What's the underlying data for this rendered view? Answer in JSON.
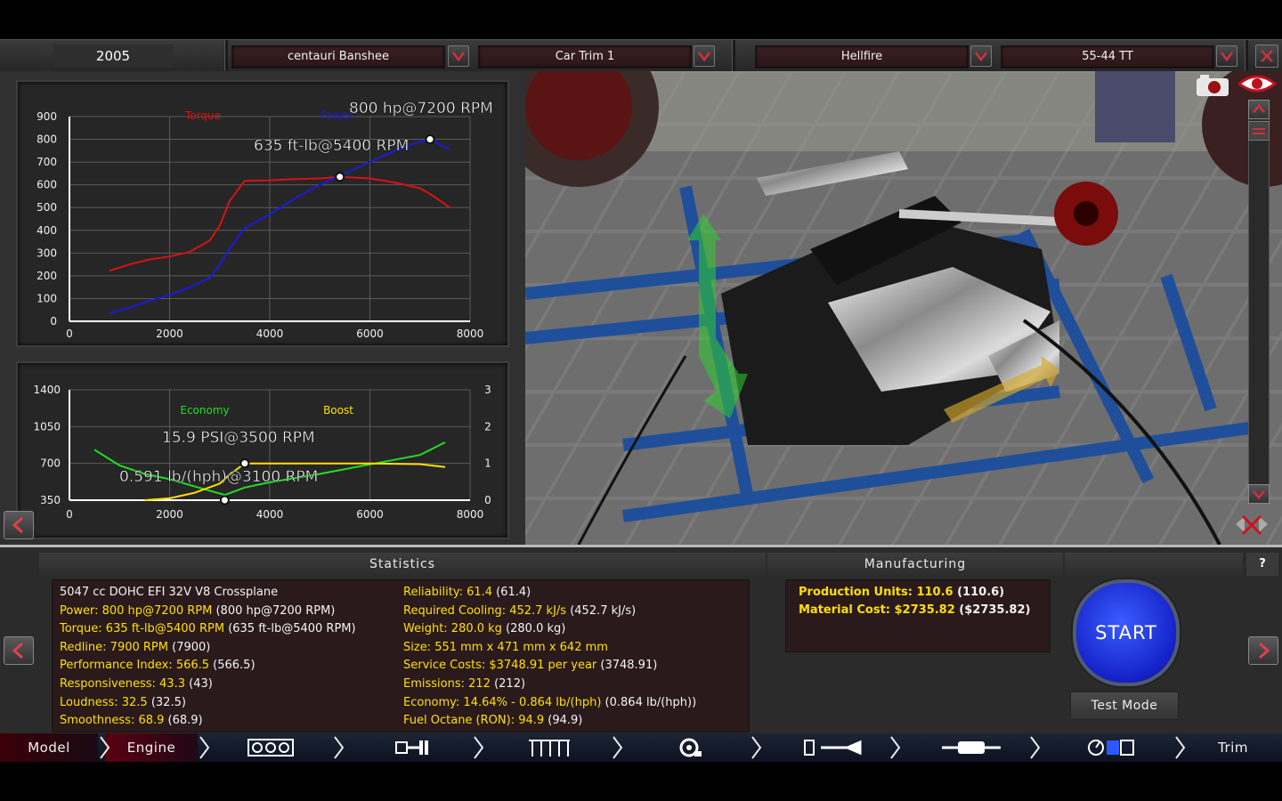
{
  "topbar": {
    "year": "2005",
    "model": "centauri Banshee",
    "trim": "Car Trim 1",
    "engine_family": "Hellfire",
    "engine_variant": "55-44 TT"
  },
  "charts": [
    {
      "name": "power-torque",
      "type": "line",
      "x_ticks": [
        "0",
        "2000",
        "4000",
        "6000",
        "8000"
      ],
      "y_ticks": [
        "900",
        "800",
        "700",
        "600",
        "500",
        "400",
        "300",
        "200",
        "100",
        "0"
      ],
      "legend": {
        "torque": "Torque",
        "power": "Power"
      },
      "annotations": {
        "power": "800 hp@7200 RPM",
        "torque": "635 ft-lb@5400 RPM"
      },
      "x": [
        800,
        1200,
        1600,
        2000,
        2400,
        2800,
        3000,
        3200,
        3500,
        4000,
        4500,
        5000,
        5400,
        6000,
        6500,
        7000,
        7200,
        7600
      ],
      "series": [
        {
          "name": "Torque",
          "color": "#d81212",
          "values": [
            222,
            250,
            272,
            285,
            305,
            355,
            420,
            530,
            618,
            620,
            625,
            628,
            635,
            628,
            610,
            585,
            560,
            500
          ]
        },
        {
          "name": "Power",
          "color": "#1a1ae0",
          "values": [
            35,
            60,
            90,
            115,
            150,
            190,
            250,
            320,
            410,
            470,
            540,
            600,
            640,
            700,
            750,
            790,
            800,
            755
          ]
        }
      ],
      "xlim": [
        0,
        8000
      ],
      "ylim": [
        0,
        900
      ]
    },
    {
      "name": "economy-boost",
      "type": "line",
      "x_ticks": [
        "0",
        "2000",
        "4000",
        "6000",
        "8000"
      ],
      "y_left_ticks": [
        "1400",
        "1050",
        "700",
        "350"
      ],
      "y_right_ticks": [
        "3",
        "2",
        "1",
        "0"
      ],
      "legend": {
        "economy": "Economy",
        "boost": "Boost"
      },
      "annotations": {
        "boost": "15.9 PSI@3500 RPM",
        "economy": "0.591 lb/(hph)@3100 RPM"
      },
      "economy_x": [
        500,
        1000,
        1500,
        2000,
        2500,
        3100,
        3500,
        4000,
        5000,
        6000,
        7000,
        7500
      ],
      "economy_values": [
        830,
        680,
        600,
        550,
        480,
        400,
        470,
        520,
        600,
        690,
        780,
        900
      ],
      "boost_x": [
        1500,
        2000,
        2500,
        3000,
        3200,
        3500,
        4000,
        5000,
        6000,
        7000,
        7500
      ],
      "boost_values": [
        0.0,
        0.05,
        0.2,
        0.45,
        0.7,
        1.0,
        1.0,
        1.0,
        1.0,
        0.98,
        0.9
      ],
      "xlim": [
        0,
        8000
      ],
      "y_left_lim": [
        350,
        1400
      ],
      "y_right_lim": [
        0,
        3
      ]
    }
  ],
  "statistics": {
    "title": "Statistics",
    "col1": [
      {
        "label": "5047 cc DOHC EFI 32V V8 Crossplane",
        "extra": ""
      },
      {
        "label": "Power: 800 hp@7200 RPM",
        "extra": " (800 hp@7200 RPM)"
      },
      {
        "label": "Torque: 635 ft-lb@5400 RPM",
        "extra": " (635 ft-lb@5400 RPM)"
      },
      {
        "label": "Redline: 7900 RPM",
        "extra": " (7900)"
      },
      {
        "label": "Performance Index: 566.5",
        "extra": " (566.5)"
      },
      {
        "label": "Responsiveness: 43.3",
        "extra": " (43)"
      },
      {
        "label": "Loudness: 32.5",
        "extra": " (32.5)"
      },
      {
        "label": "Smoothness: 68.9",
        "extra": " (68.9)"
      }
    ],
    "col2": [
      {
        "label": "Reliability: 61.4",
        "extra": " (61.4)"
      },
      {
        "label": "Required Cooling: 452.7 kJ/s",
        "extra": " (452.7 kJ/s)"
      },
      {
        "label": "Weight: 280.0 kg",
        "extra": " (280.0 kg)"
      },
      {
        "label": "Size: 551 mm x 471 mm x 642 mm",
        "extra": ""
      },
      {
        "label": "Service Costs: $3748.91 per year",
        "extra": " (3748.91)"
      },
      {
        "label": "Emissions: 212",
        "extra": " (212)"
      },
      {
        "label": "Economy: 14.64% - 0.864 lb/(hph)",
        "extra": " (0.864 lb/(hph))"
      },
      {
        "label": "Fuel Octane (RON): 94.9",
        "extra": " (94.9)"
      }
    ]
  },
  "manufacturing": {
    "title": "Manufacturing",
    "rows": [
      {
        "label": "Production Units: 110.6",
        "extra": " (110.6)"
      },
      {
        "label": "Material Cost: $2735.82",
        "extra": " ($2735.82)"
      }
    ]
  },
  "actions": {
    "start": "START",
    "test_mode": "Test Mode",
    "help": "?"
  },
  "nav": {
    "model": "Model",
    "engine": "Engine",
    "trim": "Trim"
  },
  "colors": {
    "accent_red": "#d81212",
    "power_blue": "#1a1ae0",
    "economy_green": "#22dd22",
    "boost_yellow": "#ffe000",
    "stat_yellow": "#ffe000"
  }
}
